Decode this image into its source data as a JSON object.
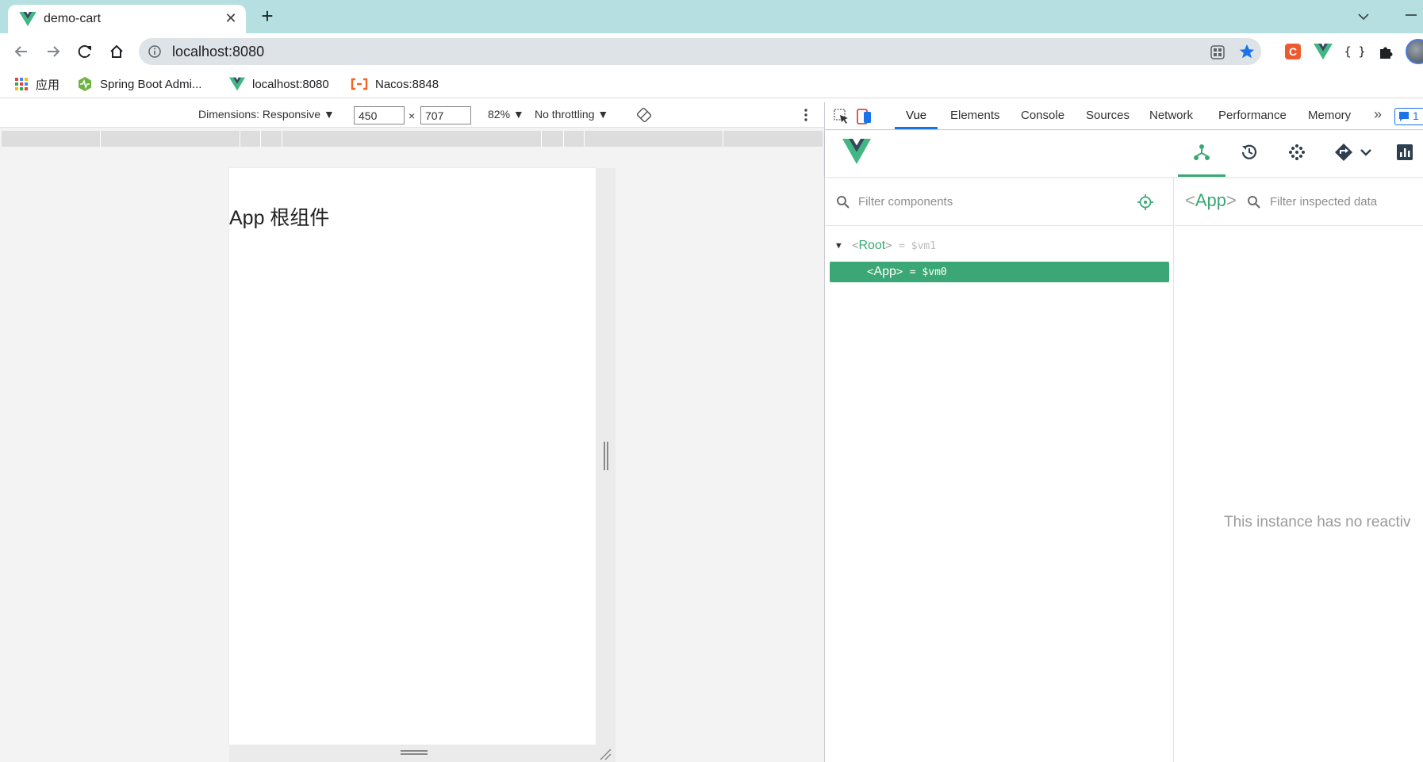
{
  "browser": {
    "tab": {
      "title": "demo-cart",
      "close_symbol": "✕"
    },
    "new_tab_symbol": "+",
    "address": {
      "url": "localhost:8080"
    },
    "bookmarks": [
      {
        "label": "应用",
        "icon": "apps-grid-icon"
      },
      {
        "label": "Spring Boot Admi...",
        "icon": "spring-boot-admin-icon"
      },
      {
        "label": "localhost:8080",
        "icon": "vue-logo-icon"
      },
      {
        "label": "Nacos:8848",
        "icon": "nacos-icon"
      }
    ],
    "extensions": [
      "extension-red-c-icon",
      "vue-devtools-icon",
      "json-viewer-icon",
      "extensions-puzzle-icon"
    ]
  },
  "emulation": {
    "dimensions_label": "Dimensions: Responsive ▼",
    "width": "450",
    "times": "×",
    "height": "707",
    "zoom": "82% ▼",
    "throttling": "No throttling ▼",
    "page_text": "App 根组件"
  },
  "devtools": {
    "tabs": [
      "Vue",
      "Elements",
      "Console",
      "Sources",
      "Network",
      "Performance",
      "Memory"
    ],
    "more_symbol": "»",
    "issues_count": "1",
    "active_tab": "Vue"
  },
  "vue": {
    "filter_components_placeholder": "Filter components",
    "tree": {
      "root": {
        "lt": "<",
        "name": "Root",
        "gt": ">",
        "assign": "= $vm1"
      },
      "app": {
        "lt": "<",
        "name": "App",
        "gt": ">",
        "assign": "= $vm0"
      }
    },
    "inspected": {
      "lt": "<",
      "name": "App",
      "gt": ">",
      "filter_placeholder": "Filter inspected data",
      "empty_message": "This instance has no reactiv"
    },
    "colors": {
      "accent": "#3ba776",
      "tab_underline": "#1a73e8",
      "tabstrip": "#b5dfe0"
    }
  }
}
